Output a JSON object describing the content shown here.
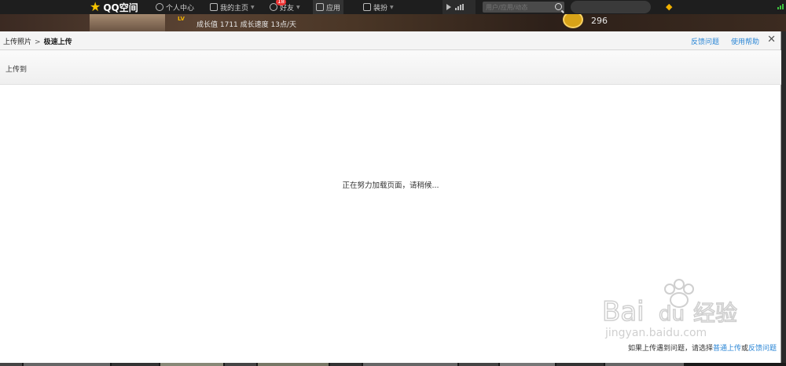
{
  "topbar": {
    "logo_text": "QQ空间",
    "nav": [
      {
        "label": "个人中心"
      },
      {
        "label": "我的主页"
      },
      {
        "label": "好友",
        "badge": "18"
      },
      {
        "label": "应用"
      },
      {
        "label": "装扮"
      }
    ],
    "search_placeholder": "用户/应用/动态"
  },
  "profile": {
    "growth_text": "成长值 1711   成长速度 13点/天",
    "vip_number": "296"
  },
  "dialog": {
    "breadcrumb_root": "上传照片",
    "breadcrumb_sep": ">",
    "breadcrumb_current": "极速上传",
    "feedback_link": "反馈问题",
    "help_link": "使用帮助",
    "close_symbol": "✕",
    "upload_to_label": "上传到",
    "loading_text": "正在努力加载页面，请稍候...",
    "footer_prefix": "如果上传遇到问题，请选择",
    "footer_normal_upload": "普通上传",
    "footer_or": "或",
    "footer_feedback": "反馈问题"
  },
  "watermark": {
    "text_top": "Bai",
    "text_mid": "du",
    "text_cn": "经验",
    "text_url": "jingyan.baidu.com"
  },
  "colors": {
    "link": "#2a86d6",
    "topbar_bg": "#1e1e1e",
    "dialog_bg": "#ffffff"
  }
}
